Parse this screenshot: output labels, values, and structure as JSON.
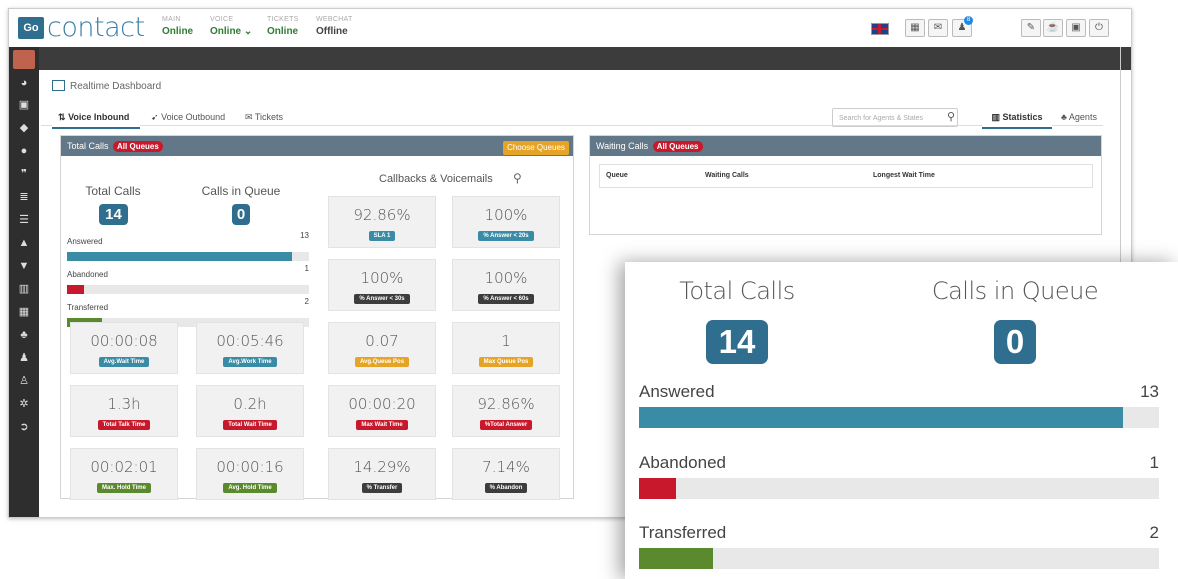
{
  "app": {
    "logo_box": "Go",
    "logo_text": "contact"
  },
  "status": [
    {
      "label": "MAIN",
      "value": "Online"
    },
    {
      "label": "VOICE",
      "value": "Online ⌄"
    },
    {
      "label": "TICKETS",
      "value": "Online"
    },
    {
      "label": "WEBCHAT",
      "value": "Offline"
    }
  ],
  "notification_count": "8",
  "page_title": "Realtime Dashboard",
  "tabs": {
    "voice_inbound": "Voice Inbound",
    "voice_outbound": "Voice Outbound",
    "tickets": "Tickets",
    "statistics": "Statistics",
    "agents": "Agents"
  },
  "search": {
    "placeholder": "Search for Agents & States"
  },
  "total_panel": {
    "title": "Total Calls",
    "badge": "All Queues",
    "choose_queues": "Choose Queues",
    "total_calls_label": "Total Calls",
    "total_calls": "14",
    "calls_in_queue_label": "Calls in Queue",
    "calls_in_queue": "0",
    "callbacks_label": "Callbacks & Voicemails",
    "bars": [
      {
        "label": "Answered",
        "count": "13",
        "fraction": 0.93,
        "color": "#3a8ca6"
      },
      {
        "label": "Abandoned",
        "count": "1",
        "fraction": 0.071,
        "color": "#c7192b"
      },
      {
        "label": "Transferred",
        "count": "2",
        "fraction": 0.143,
        "color": "#5b8a2e"
      }
    ]
  },
  "cards": [
    {
      "value": "92.86%",
      "tag": "SLA 1",
      "color": "#3a8ca6"
    },
    {
      "value": "100%",
      "tag": "% Answer < 20s",
      "color": "#3a8ca6"
    },
    {
      "value": "100%",
      "tag": "% Answer < 30s",
      "color": "#3d3d3d"
    },
    {
      "value": "100%",
      "tag": "% Answer < 60s",
      "color": "#3d3d3d"
    },
    {
      "value": "00:00:08",
      "tag": "Avg.Wait Time",
      "color": "#3a8ca6"
    },
    {
      "value": "00:05:46",
      "tag": "Avg.Work Time",
      "color": "#3a8ca6"
    },
    {
      "value": "0.07",
      "tag": "Avg.Queue Pos",
      "color": "#e6a427"
    },
    {
      "value": "1",
      "tag": "Max Queue Pos",
      "color": "#e6a427"
    },
    {
      "value": "1.3h",
      "tag": "Total Talk Time",
      "color": "#c7192b"
    },
    {
      "value": "0.2h",
      "tag": "Total Wait Time",
      "color": "#c7192b"
    },
    {
      "value": "00:00:20",
      "tag": "Max Wait Time",
      "color": "#c7192b"
    },
    {
      "value": "92.86%",
      "tag": "%Total Answer",
      "color": "#c7192b"
    },
    {
      "value": "00:02:01",
      "tag": "Max. Hold Time",
      "color": "#5b8a2e"
    },
    {
      "value": "00:00:16",
      "tag": "Avg. Hold Time",
      "color": "#5b8a2e"
    },
    {
      "value": "14.29%",
      "tag": "% Transfer",
      "color": "#3d3d3d"
    },
    {
      "value": "7.14%",
      "tag": "% Abandon",
      "color": "#3d3d3d"
    }
  ],
  "waiting_panel": {
    "title": "Waiting Calls",
    "badge": "All Queues",
    "columns": [
      "Queue",
      "Waiting Calls",
      "Longest Wait Time"
    ]
  },
  "zoom": {
    "total_calls_label": "Total Calls",
    "total_calls": "14",
    "calls_in_queue_label": "Calls in Queue",
    "calls_in_queue": "0",
    "bars": [
      {
        "label": "Answered",
        "count": "13",
        "fraction": 0.93,
        "color": "#3a8ca6"
      },
      {
        "label": "Abandoned",
        "count": "1",
        "fraction": 0.071,
        "color": "#c7192b"
      },
      {
        "label": "Transferred",
        "count": "2",
        "fraction": 0.143,
        "color": "#5b8a2e"
      }
    ]
  }
}
